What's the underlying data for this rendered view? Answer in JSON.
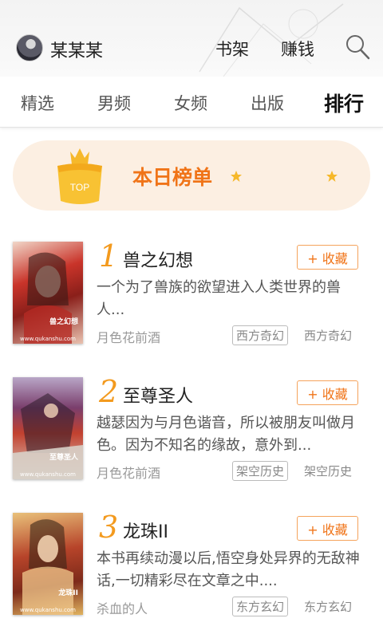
{
  "header": {
    "username": "某某某",
    "nav": [
      "书架",
      "赚钱"
    ],
    "search_icon": "search-icon"
  },
  "tabs": [
    {
      "label": "精选",
      "active": false
    },
    {
      "label": "男频",
      "active": false
    },
    {
      "label": "女频",
      "active": false
    },
    {
      "label": "出版",
      "active": false
    },
    {
      "label": "排行",
      "active": true
    }
  ],
  "banner": {
    "badge": "TOP",
    "title": "本日榜单",
    "accent": "#f07418"
  },
  "fav_label": "+ 收藏",
  "books": [
    {
      "rank": "1",
      "title": "兽之幻想",
      "desc": "一个为了兽族的欲望进入人类世界的兽人...",
      "author": "月色花前酒",
      "tag": "西方奇幻",
      "category": "西方奇幻",
      "cover_title": "兽之幻想",
      "cover_site": "www.qukanshu.com"
    },
    {
      "rank": "2",
      "title": "至尊圣人",
      "desc": "越瑟因为与月色谐音，所以被朋友叫做月色。因为不知名的缘故，意外到...",
      "author": "月色花前酒",
      "tag": "架空历史",
      "category": "架空历史",
      "cover_title": "至尊圣人",
      "cover_site": "www.qukanshu.com"
    },
    {
      "rank": "3",
      "title": "龙珠II",
      "desc": "本书再续动漫以后,悟空身处异界的无敌神话,一切精彩尽在文章之中....",
      "author": "杀血的人",
      "tag": "东方玄幻",
      "category": "东方玄幻",
      "cover_title": "龙珠II",
      "cover_site": "www.qukanshu.com"
    }
  ]
}
